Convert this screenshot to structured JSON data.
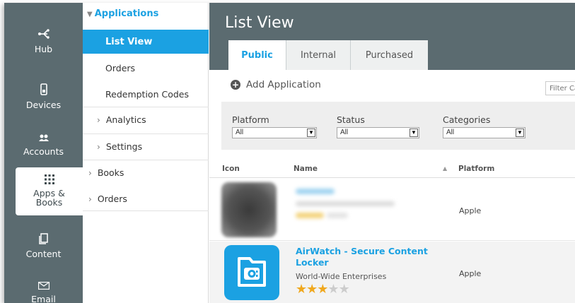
{
  "rail": {
    "items": [
      {
        "label": "Hub",
        "icon": "hub-icon"
      },
      {
        "label": "Devices",
        "icon": "device-icon"
      },
      {
        "label": "Accounts",
        "icon": "accounts-icon"
      },
      {
        "label": "Apps &",
        "label2": "Books",
        "icon": "apps-grid-icon"
      },
      {
        "label": "Content",
        "icon": "content-icon"
      },
      {
        "label": "Email",
        "icon": "email-icon"
      }
    ]
  },
  "subnav": {
    "header": "Applications",
    "active": "List View",
    "items": [
      "Orders",
      "Redemption Codes",
      "Analytics",
      "Settings"
    ],
    "groups": [
      "Books",
      "Orders"
    ]
  },
  "main": {
    "title": "List View",
    "tabs": [
      "Public",
      "Internal",
      "Purchased"
    ],
    "add_label": "Add Application",
    "filter_placeholder": "Filter Ca"
  },
  "filters": [
    {
      "label": "Platform",
      "value": "All"
    },
    {
      "label": "Status",
      "value": "All"
    },
    {
      "label": "Categories",
      "value": "All"
    }
  ],
  "table": {
    "headers": {
      "icon": "Icon",
      "name": "Name",
      "platform": "Platform"
    },
    "rows": [
      {
        "platform": "Apple"
      },
      {
        "name_line1": "AirWatch - Secure Content",
        "name_line2": "Locker",
        "developer": "World-Wide Enterprises",
        "rating": 3,
        "max_rating": 5,
        "platform": "Apple"
      }
    ]
  },
  "colors": {
    "accent": "#1ba1e2",
    "sidebar": "#5b6b70",
    "star": "#f0a81e"
  }
}
